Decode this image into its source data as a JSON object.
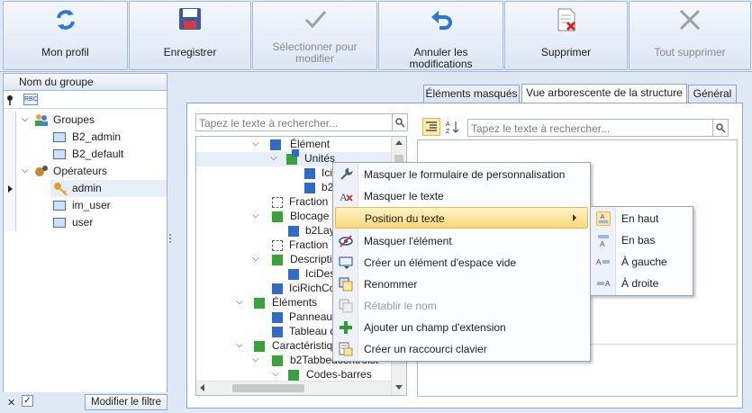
{
  "toolbar": {
    "profile": "Mon profil",
    "save": "Enregistrer",
    "select_edit": "Sélectionner pour modifier",
    "undo": "Annuler les modifications",
    "delete": "Supprimer",
    "delete_all": "Tout supprimer"
  },
  "left": {
    "header": "Nom du groupe",
    "filter_glyph": "RBC",
    "groups_label": "Groupes",
    "groups": [
      "B2_admin",
      "B2_default"
    ],
    "operators_label": "Opérateurs",
    "operators": [
      "admin",
      "im_user",
      "user"
    ],
    "filter_button": "Modifier le filtre"
  },
  "tabs": [
    "Éléments masqués",
    "Vue arborescente de la structure",
    "Général"
  ],
  "search_placeholder": "Tapez le texte à rechercher...",
  "tree": [
    {
      "label": "Élément"
    },
    {
      "label": "Unités"
    },
    {
      "label": "Ici"
    },
    {
      "label": "b2"
    },
    {
      "label": "Fraction"
    },
    {
      "label": "Blocage d"
    },
    {
      "label": "b2Lay"
    },
    {
      "label": "Fraction"
    },
    {
      "label": "Descriptio"
    },
    {
      "label": "IciDes"
    },
    {
      "label": "IciRichCo"
    },
    {
      "label": "Éléments"
    },
    {
      "label": "Panneau"
    },
    {
      "label": "Tableau d"
    },
    {
      "label": "Caractéristique"
    },
    {
      "label": "b2Tabbedcontrolst"
    },
    {
      "label": "Codes-barres"
    }
  ],
  "context_menu": [
    {
      "label": "Masquer le formulaire de personnalisation",
      "icon": "wrench-icon"
    },
    {
      "label": "Masquer le texte",
      "icon": "hide-text-icon"
    },
    {
      "label": "Position du texte",
      "icon": "",
      "submenu": true
    },
    {
      "label": "Masquer l'élément",
      "icon": "hide-eye-icon"
    },
    {
      "label": "Créer un élément d'espace vide",
      "icon": "empty-space-icon"
    },
    {
      "label": "Renommer",
      "icon": "rename-icon"
    },
    {
      "label": "Rétablir le nom",
      "icon": "restore-name-icon",
      "disabled": true
    },
    {
      "label": "Ajouter un champ d'extension",
      "icon": "plus-icon"
    },
    {
      "label": "Créer un raccourci clavier",
      "icon": "keyboard-shortcut-icon"
    }
  ],
  "submenu": [
    {
      "label": "En haut",
      "icon": "text-top-icon",
      "checked": true
    },
    {
      "label": "En bas",
      "icon": "text-bottom-icon"
    },
    {
      "label": "À gauche",
      "icon": "text-left-icon"
    },
    {
      "label": "À droite",
      "icon": "text-right-icon"
    }
  ],
  "colors": {
    "accent": "#dfe8f5",
    "blue_node": "#2f6bc7",
    "green_node": "#3aa23a",
    "highlight": "#f8d97a"
  }
}
